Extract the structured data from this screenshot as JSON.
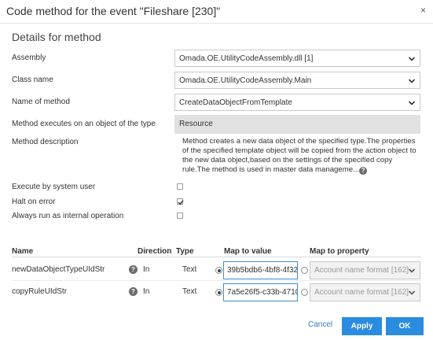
{
  "dialog": {
    "title": "Code method for the event \"Fileshare [230]\"",
    "close_symbol": "×"
  },
  "section_title": "Details for method",
  "fields": {
    "assembly": {
      "label": "Assembly",
      "value": "Omada.OE.UtilityCodeAssembly.dll [1]"
    },
    "class_name": {
      "label": "Class name",
      "value": "Omada.OE.UtilityCodeAssembly.Main"
    },
    "method_name": {
      "label": "Name of method",
      "value": "CreateDataObjectFromTemplate"
    },
    "object_type": {
      "label": "Method executes on an object of the type",
      "value": "Resource"
    },
    "description": {
      "label": "Method description",
      "value": "Method creates a new data object of the specified type.The properties of the specified template object will be copied from the action object to the new data object,based on the settings of the specified copy rule.The method is used in master data manageme..."
    },
    "execute_system_user": {
      "label": "Execute by system user",
      "checked": false
    },
    "halt_on_error": {
      "label": "Halt on error",
      "checked": true
    },
    "internal_operation": {
      "label": "Always run as internal operation",
      "checked": false
    }
  },
  "table": {
    "headers": {
      "name": "Name",
      "direction": "Direction",
      "type": "Type",
      "map_to_value": "Map to value",
      "map_to_property": "Map to property"
    },
    "rows": [
      {
        "name": "newDataObjectTypeUIdStr",
        "help": "?",
        "direction": "In",
        "type": "Text",
        "value": "39b5bdb6-4bf8-4f32-",
        "property": "Account name format [162]"
      },
      {
        "name": "copyRuleUIdStr",
        "help": "?",
        "direction": "In",
        "type": "Text",
        "value": "7a5e26f5-c33b-4710-",
        "property": "Account name format [162]"
      }
    ]
  },
  "buttons": {
    "cancel": "Cancel",
    "apply": "Apply",
    "ok": "OK"
  },
  "colors": {
    "primary": "#2a8ce0",
    "link": "#2f7cc0",
    "readonly_bg": "#e1e1e1"
  }
}
